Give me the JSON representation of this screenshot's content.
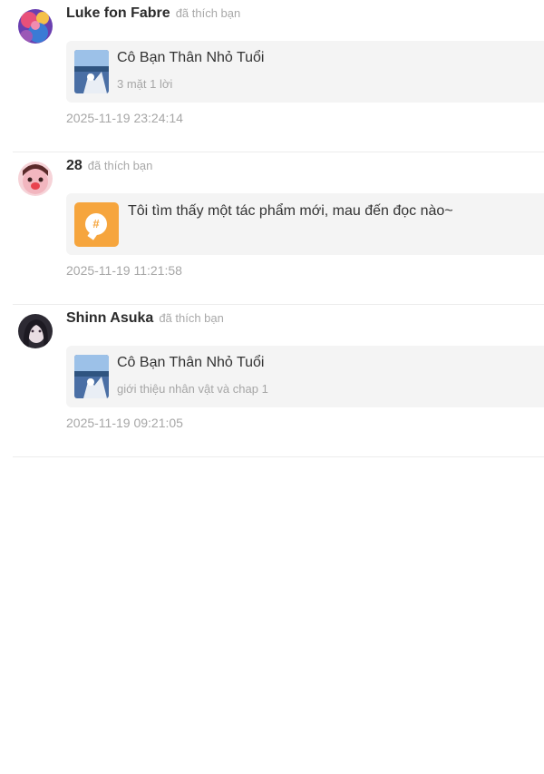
{
  "notifications": [
    {
      "user": "Luke fon Fabre",
      "action": "đã thích bạn",
      "avatar_icon": "user-avatar-colorful",
      "card": {
        "type": "work",
        "thumb_icon": "cover-thumbnail-icon",
        "title": "Cô Bạn Thân Nhỏ Tuổi",
        "subtitle": "3 mặt 1 lời"
      },
      "time": "2025-11-19 23:24:14"
    },
    {
      "user": "28",
      "action": "đã thích bạn",
      "avatar_icon": "user-avatar-pink",
      "card": {
        "type": "post",
        "thumb_icon": "hashtag-bubble-icon",
        "text": "Tôi tìm thấy một tác phẩm mới, mau đến đọc nào~"
      },
      "time": "2025-11-19 11:21:58"
    },
    {
      "user": "Shinn Asuka",
      "action": "đã thích bạn",
      "avatar_icon": "user-avatar-dark",
      "card": {
        "type": "work",
        "thumb_icon": "cover-thumbnail-icon",
        "title": "Cô Bạn Thân Nhỏ Tuổi",
        "subtitle": "giới thiệu nhân vật và chap 1"
      },
      "time": "2025-11-19 09:21:05"
    }
  ],
  "colors": {
    "accent": "#f6a53d",
    "card_bg": "#f4f4f4",
    "muted_text": "#a6a6a6",
    "divider": "#ececec"
  }
}
